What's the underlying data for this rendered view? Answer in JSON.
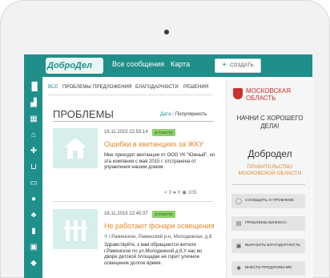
{
  "header": {
    "logo": "ДоброДел",
    "nav": [
      "Все сообщения",
      "Карта"
    ],
    "create_label": "СОЗДАТЬ"
  },
  "sidebar_icons": [
    "city-icon",
    "chart-icon",
    "building-icon",
    "home-icon",
    "hospital-icon",
    "cart-icon",
    "book-icon",
    "map-pin-icon",
    "tree-icon",
    "trash-icon",
    "bus-icon",
    "brush-icon"
  ],
  "tabs": [
    "ВСЕ",
    "ПРОБЛЕМЫ",
    "ПРЕДЛОЖЕНИЯ",
    "БЛАГОДАРНОСТИ",
    "РЕШЕНИЯ"
  ],
  "section": {
    "title": "ПРОБЛЕМЫ",
    "sort_date": "Дата",
    "sort_pop": "Популярность"
  },
  "cards": [
    {
      "date": "16.11.2015 22:53:14",
      "status": "В РАБОТЕ",
      "title": "Ошибки в квитанциях за ЖКУ",
      "text": "Мне приходят квитанции от ООО УК \"Южный\", но эта компания с мая 2015 г. отстранена от управления нашим домом.",
      "meta": {
        "shares": "0",
        "comments": "0",
        "views": "105"
      }
    },
    {
      "date": "16.11.2015 22:45:37",
      "status": "В РАБОТЕ",
      "title": "Не работают фонари освещения",
      "location": "г.Раменское, Раменский р-н, Молодежная, д.8",
      "text": "Здравствуйте, к вам обращаются жители г.Раменское по ул.Молодежной д.8,У нас во дворе детской площадке не горит уличное освещение долгое время."
    }
  ],
  "right_panel": {
    "region_line1": "МОСКОВСКАЯ",
    "region_line2": "ОБЛАСТЬ",
    "greeting": "НАЧНИ С ХОРОШЕГО ДЕЛА!",
    "name": "Добродел",
    "gov_line1": "ПРАВИТЕЛЬСТВО",
    "gov_line2": "МОСКОВСКОЙ ОБЛАСТИ",
    "buttons": [
      {
        "label": "СООБЩИТЬ О ПРОБЛЕМЕ",
        "icon": "chat-icon"
      },
      {
        "label": "ПРОБЛЕМЫ БИЗНЕСА",
        "icon": "briefcase-icon"
      },
      {
        "label": "ВЫРАЗИТЬ БЛАГОДАРНОСТЬ",
        "icon": "gift-icon"
      },
      {
        "label": "ВНЕСТИ ПРЕДЛОЖЕНИЕ",
        "icon": "lightbulb-icon"
      }
    ]
  },
  "colors": {
    "accent": "#1f8f8a",
    "title": "#e08a2c",
    "badge": "#8dd06a",
    "region": "#c8312e"
  }
}
